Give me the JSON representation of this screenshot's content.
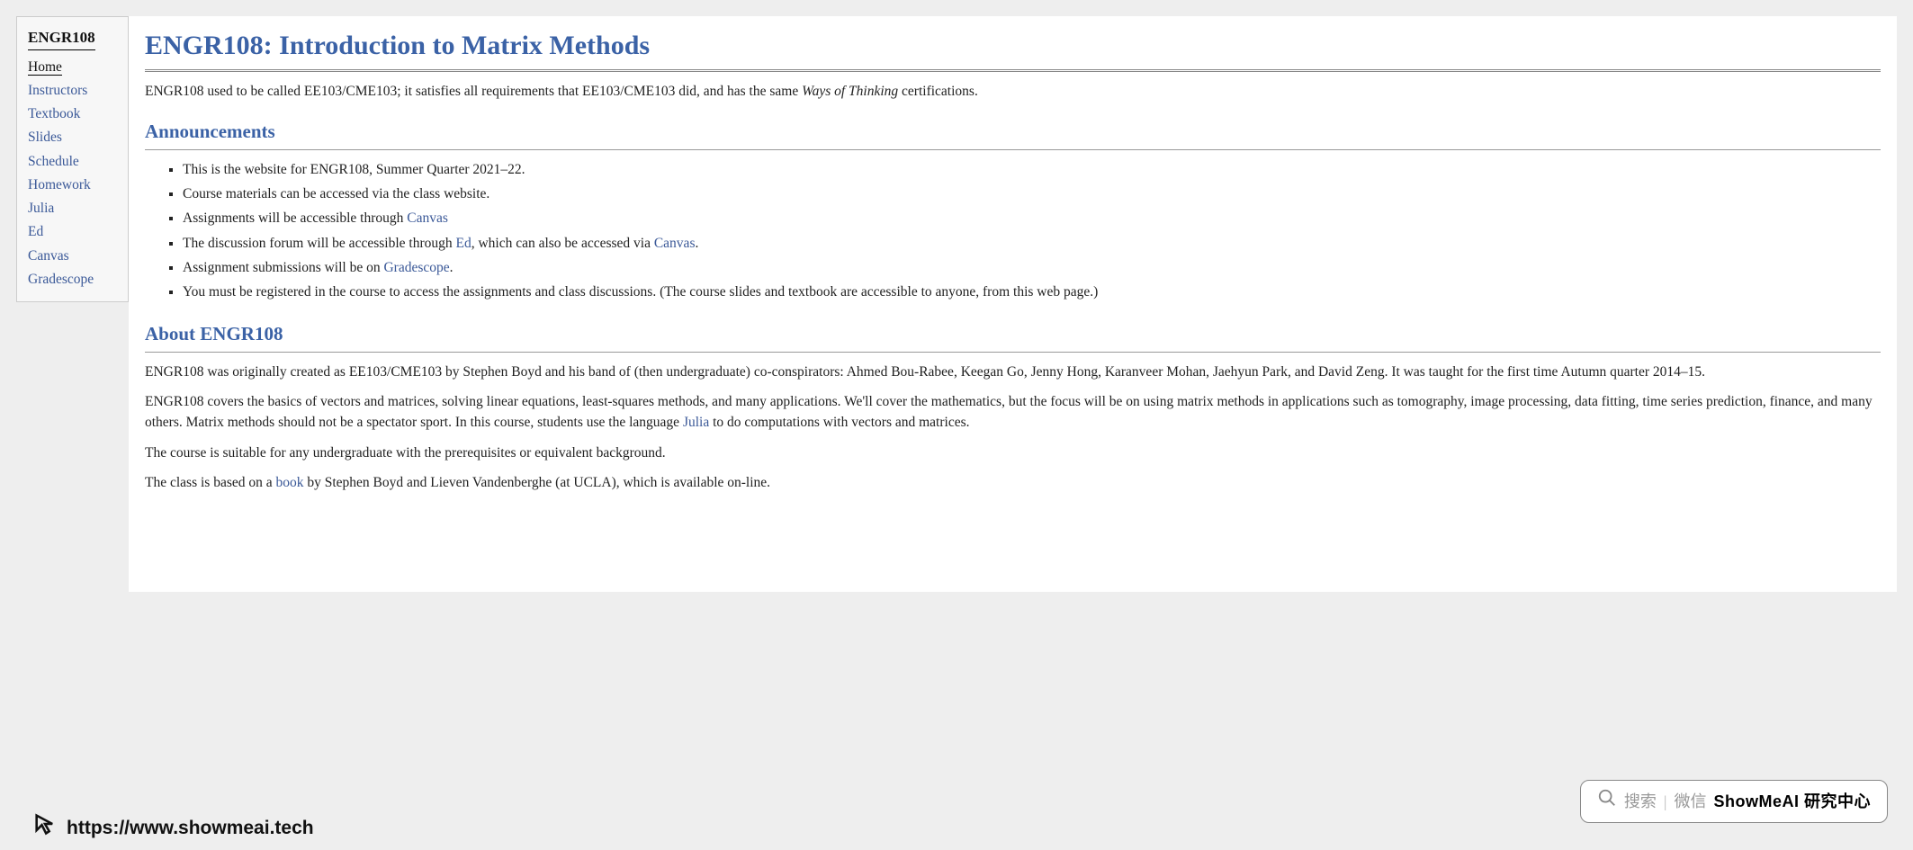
{
  "sidebar": {
    "title": "ENGR108",
    "items": [
      {
        "label": "Home",
        "active": true
      },
      {
        "label": "Instructors",
        "active": false
      },
      {
        "label": "Textbook",
        "active": false
      },
      {
        "label": "Slides",
        "active": false
      },
      {
        "label": "Schedule",
        "active": false
      },
      {
        "label": "Homework",
        "active": false
      },
      {
        "label": "Julia",
        "active": false
      },
      {
        "label": "Ed",
        "active": false
      },
      {
        "label": "Canvas",
        "active": false
      },
      {
        "label": "Gradescope",
        "active": false
      }
    ]
  },
  "title": "ENGR108: Introduction to Matrix Methods",
  "intro_pre": "ENGR108 used to be called EE103/CME103; it satisfies all requirements that EE103/CME103 did, and has the same ",
  "intro_italic": "Ways of Thinking",
  "intro_post": " certifications.",
  "announcements": {
    "heading": "Announcements",
    "items": {
      "a0": "This is the website for ENGR108, Summer Quarter 2021–22.",
      "a1": "Course materials can be accessed via the class website.",
      "a2_pre": "Assignments will be accessible through ",
      "a2_link": "Canvas",
      "a3_pre": "The discussion forum will be accessible through ",
      "a3_link1": "Ed",
      "a3_mid": ", which can also be accessed via ",
      "a3_link2": "Canvas",
      "a3_post": ".",
      "a4_pre": "Assignment submissions will be on ",
      "a4_link": "Gradescope",
      "a4_post": ".",
      "a5": "You must be registered in the course to access the assignments and class discussions. (The course slides and textbook are accessible to anyone, from this web page.)"
    }
  },
  "about": {
    "heading": "About ENGR108",
    "p1": "ENGR108 was originally created as EE103/CME103 by Stephen Boyd and his band of (then undergraduate) co-conspirators: Ahmed Bou-Rabee, Keegan Go, Jenny Hong, Karanveer Mohan, Jaehyun Park, and David Zeng. It was taught for the first time Autumn quarter 2014–15.",
    "p2_pre": "ENGR108 covers the basics of vectors and matrices, solving linear equations, least-squares methods, and many applications. We'll cover the mathematics, but the focus will be on using matrix methods in applications such as tomography, image processing, data fitting, time series prediction, finance, and many others. Matrix methods should not be a spectator sport. In this course, students use the language ",
    "p2_link": "Julia",
    "p2_post": " to do computations with vectors and matrices.",
    "p3": "The course is suitable for any undergraduate with the prerequisites or equivalent background.",
    "p4_pre": "The class is based on a ",
    "p4_link": "book",
    "p4_post": " by Stephen Boyd and Lieven Vandenberghe (at UCLA), which is available on-line."
  },
  "watermark": {
    "search_label": "搜索",
    "wechat_label": "微信",
    "brand": "ShowMeAI 研究中心"
  },
  "footer_url": "https://www.showmeai.tech"
}
